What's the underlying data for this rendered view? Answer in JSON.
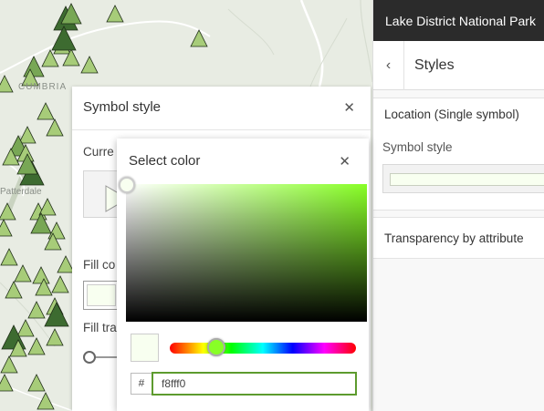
{
  "map": {
    "labels": [
      "CUMBRIA",
      "Patterdale"
    ],
    "colors": {
      "background": "#e8ece3",
      "triangle_light": "#a7cc79",
      "triangle_mid": "#78a755",
      "triangle_dark": "#3d6b30",
      "stroke": "#1d2b16"
    }
  },
  "app": {
    "title": "Lake District National Park"
  },
  "styles_panel": {
    "back_icon": "chevron-left-icon",
    "title": "Styles",
    "location_title": "Location (Single symbol)",
    "symbol_style_label": "Symbol style",
    "transparency_title": "Transparency by attribute"
  },
  "symbol_style_panel": {
    "title": "Symbol style",
    "close_glyph": "✕",
    "current_label": "Curre",
    "fill_color_label": "Fill co",
    "fill_transparency_label": "Fill tra"
  },
  "color_picker": {
    "title": "Select color",
    "close_glyph": "✕",
    "hex_prefix": "#",
    "hex_value": "f8fff0",
    "selected_color": "#f8fff0",
    "hue_color": "#88ff26"
  }
}
